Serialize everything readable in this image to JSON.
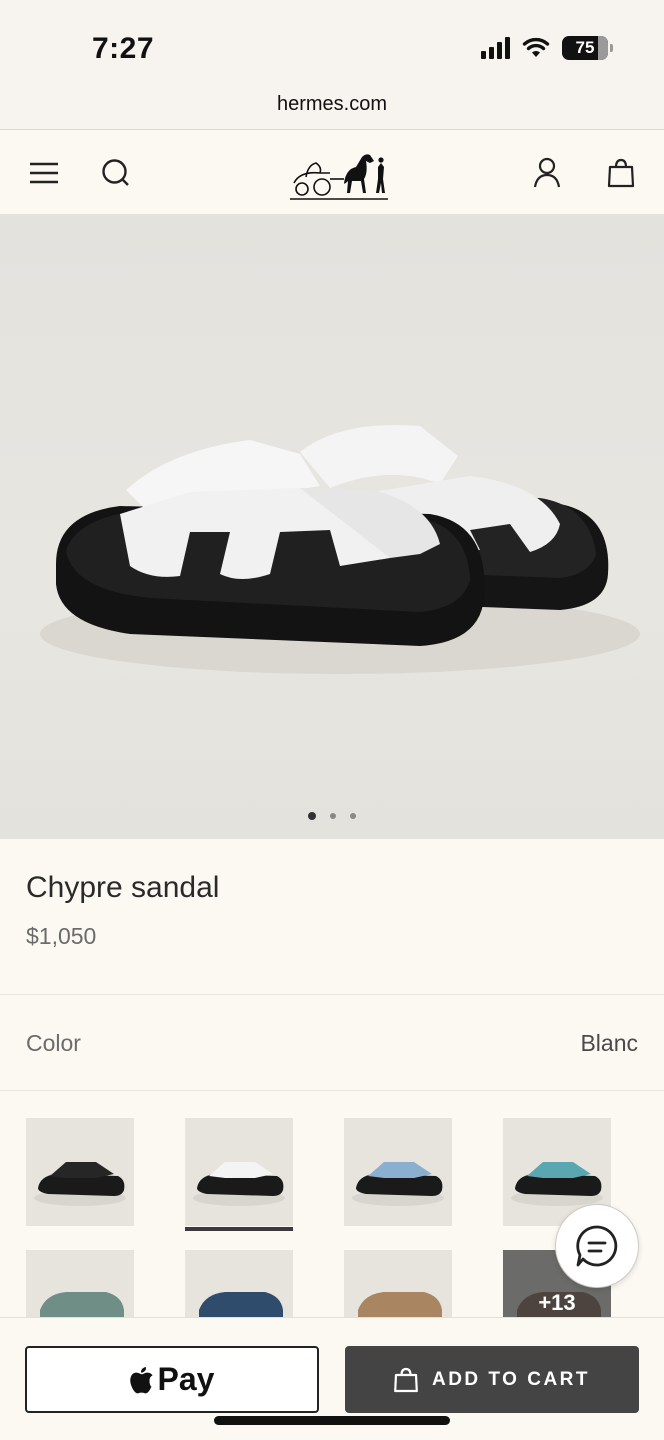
{
  "status_bar": {
    "time": "7:27",
    "battery": "75"
  },
  "browser": {
    "url": "hermes.com"
  },
  "header": {
    "icons": [
      "menu-icon",
      "search-icon",
      "hermes-logo",
      "account-icon",
      "shopping-bag-icon"
    ]
  },
  "hero": {
    "image": "white sandal pair",
    "carousel_dots": 3,
    "active_dot": 0
  },
  "product": {
    "name": "Chypre sandal",
    "price": "$1,050"
  },
  "color": {
    "label": "Color",
    "value": "Blanc",
    "swatches": [
      {
        "name": "black",
        "color": "#262626"
      },
      {
        "name": "white",
        "color": "#f4f4f4",
        "selected": true
      },
      {
        "name": "light blue",
        "color": "#8bb0cf"
      },
      {
        "name": "turquoise",
        "color": "#5aa7b2"
      },
      {
        "name": "sage green",
        "color": "#6f8f86"
      },
      {
        "name": "navy",
        "color": "#2f4c6c"
      },
      {
        "name": "tan",
        "color": "#a98562"
      },
      {
        "name": "more",
        "color": "#7a5a48"
      }
    ],
    "more_count": "+13"
  },
  "actions": {
    "apple_pay_label": "Pay",
    "add_to_cart_label": "ADD TO CART"
  }
}
